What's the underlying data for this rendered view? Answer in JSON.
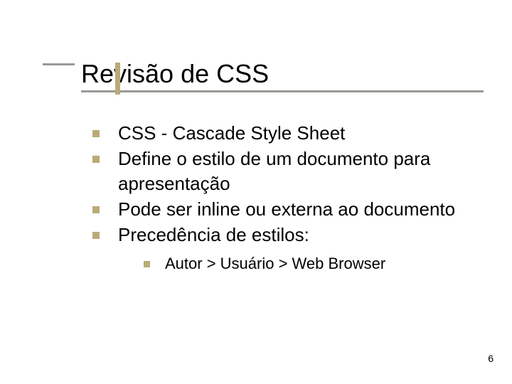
{
  "title": "Revisão de CSS",
  "bullets": [
    {
      "text": "CSS - Cascade Style Sheet"
    },
    {
      "text": "Define o estilo de um documento para apresentação"
    },
    {
      "text": "Pode ser inline ou externa ao documento"
    },
    {
      "text": "Precedência de estilos:"
    }
  ],
  "sub_bullets": [
    {
      "text": "Autor > Usuário > Web Browser"
    }
  ],
  "page_number": "6",
  "colors": {
    "accent": "#baaa78",
    "rule": "#9b9994"
  }
}
